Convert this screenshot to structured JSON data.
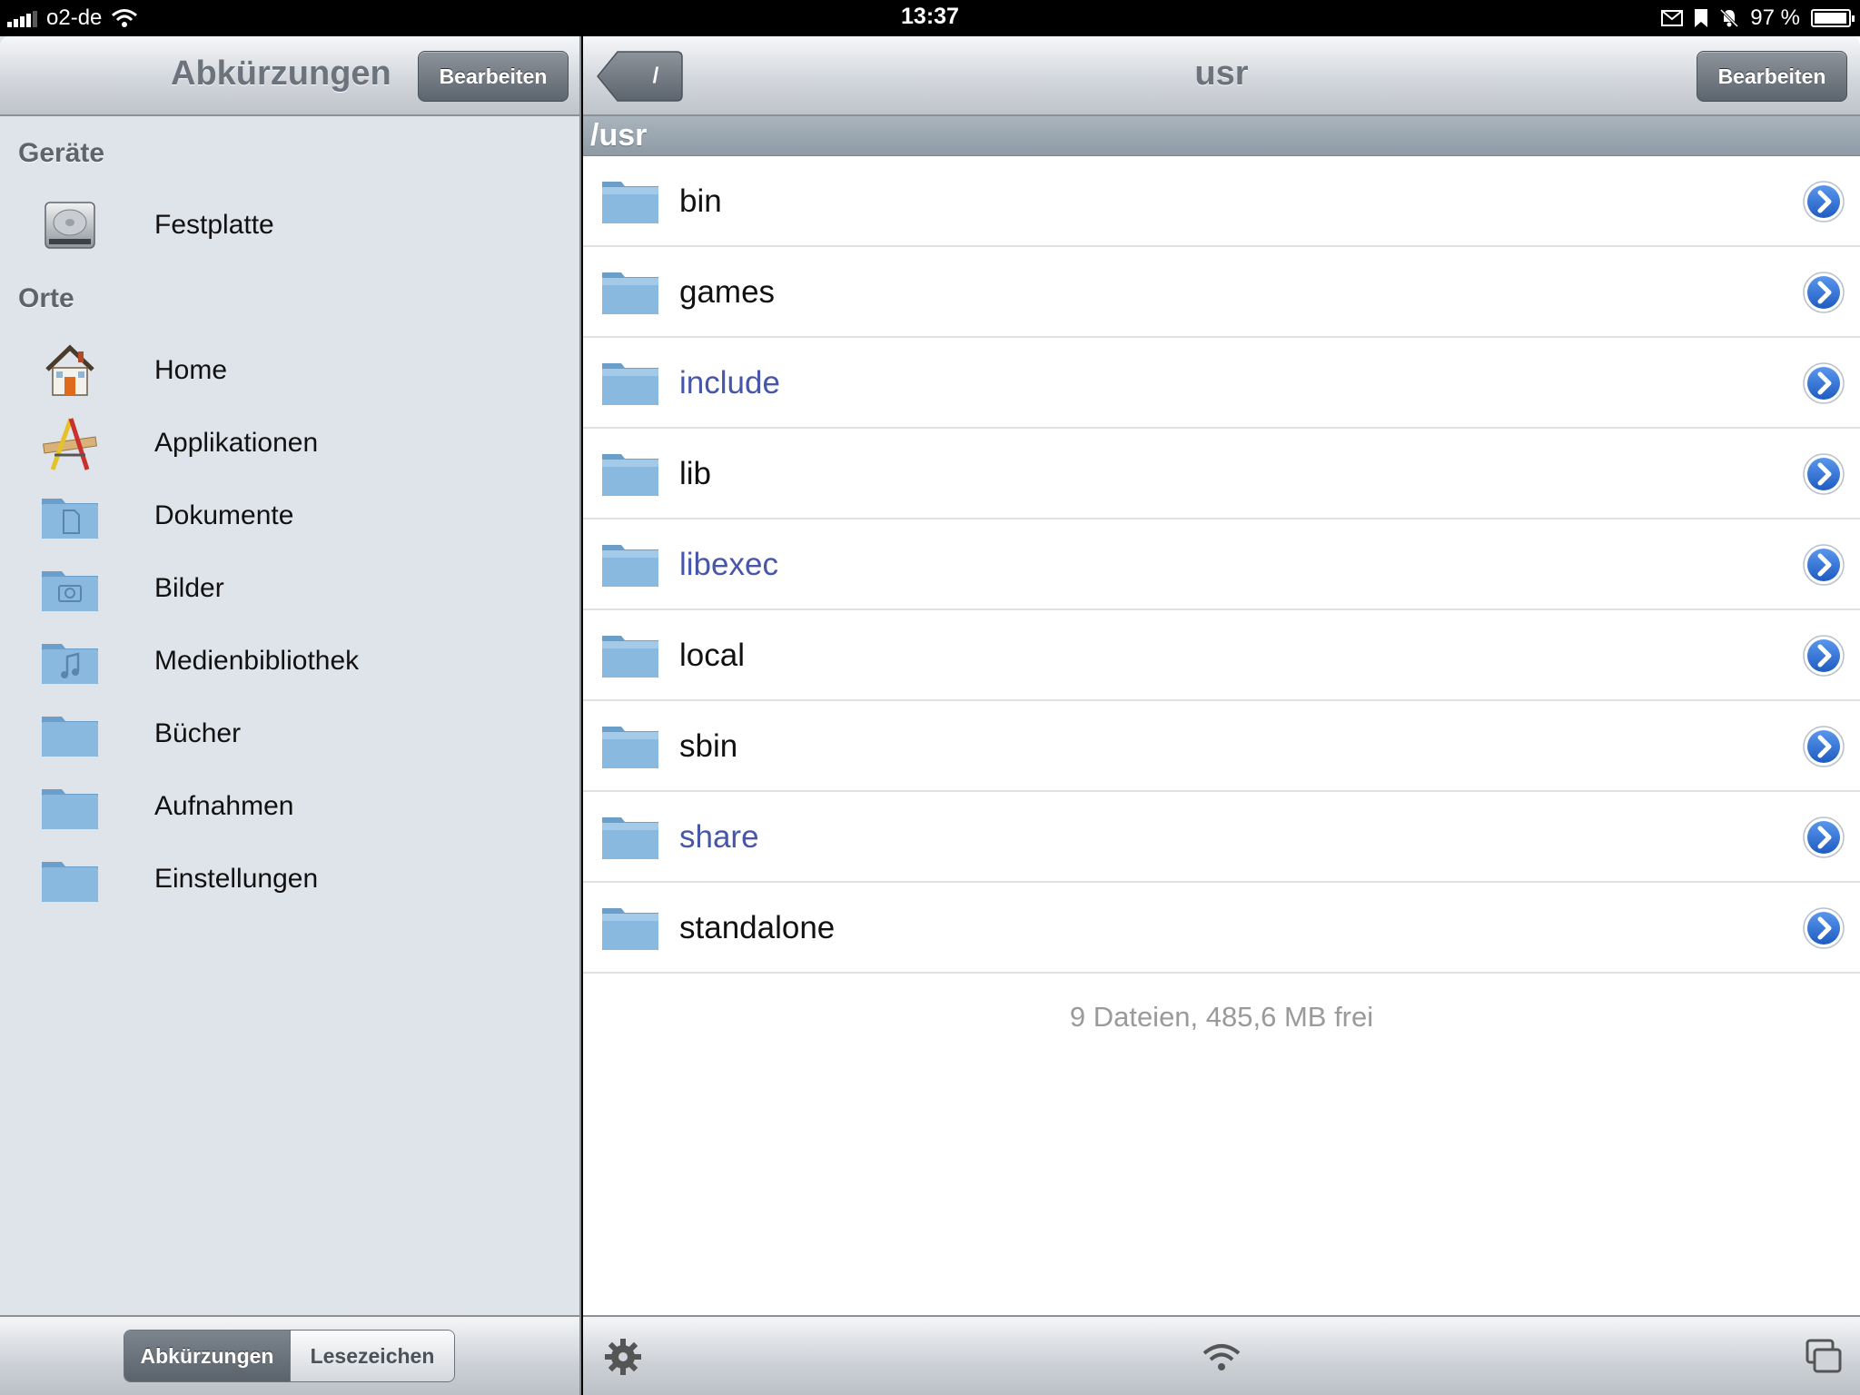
{
  "status_bar": {
    "carrier": "o2-de",
    "time": "13:37",
    "battery_percent_text": "97 %",
    "battery_level": 0.97
  },
  "left": {
    "title": "Abkürzungen",
    "edit_label": "Bearbeiten",
    "devices_title": "Geräte",
    "devices": [
      {
        "label": "Festplatte",
        "icon": "hard-drive-icon"
      }
    ],
    "places_title": "Orte",
    "places": [
      {
        "label": "Home",
        "icon": "house-icon"
      },
      {
        "label": "Applikationen",
        "icon": "applications-icon"
      },
      {
        "label": "Dokumente",
        "icon": "documents-folder-icon"
      },
      {
        "label": "Bilder",
        "icon": "pictures-folder-icon"
      },
      {
        "label": "Medienbibliothek",
        "icon": "music-folder-icon"
      },
      {
        "label": "Bücher",
        "icon": "folder-icon"
      },
      {
        "label": "Aufnahmen",
        "icon": "folder-icon"
      },
      {
        "label": "Einstellungen",
        "icon": "folder-icon"
      }
    ],
    "segments": [
      {
        "label": "Abkürzungen",
        "selected": true
      },
      {
        "label": "Lesezeichen",
        "selected": false
      }
    ]
  },
  "right": {
    "back_label": "/",
    "title": "usr",
    "edit_label": "Bearbeiten",
    "path": "/usr",
    "files": [
      {
        "name": "bin",
        "link": false
      },
      {
        "name": "games",
        "link": false
      },
      {
        "name": "include",
        "link": true
      },
      {
        "name": "lib",
        "link": false
      },
      {
        "name": "libexec",
        "link": true
      },
      {
        "name": "local",
        "link": false
      },
      {
        "name": "sbin",
        "link": false
      },
      {
        "name": "share",
        "link": true
      },
      {
        "name": "standalone",
        "link": false
      }
    ],
    "footer": "9 Dateien, 485,6 MB frei"
  },
  "colors": {
    "link_text": "#4756a6",
    "disclosure_blue": "#2f6fd6",
    "folder_blue": "#7fb0d8"
  }
}
